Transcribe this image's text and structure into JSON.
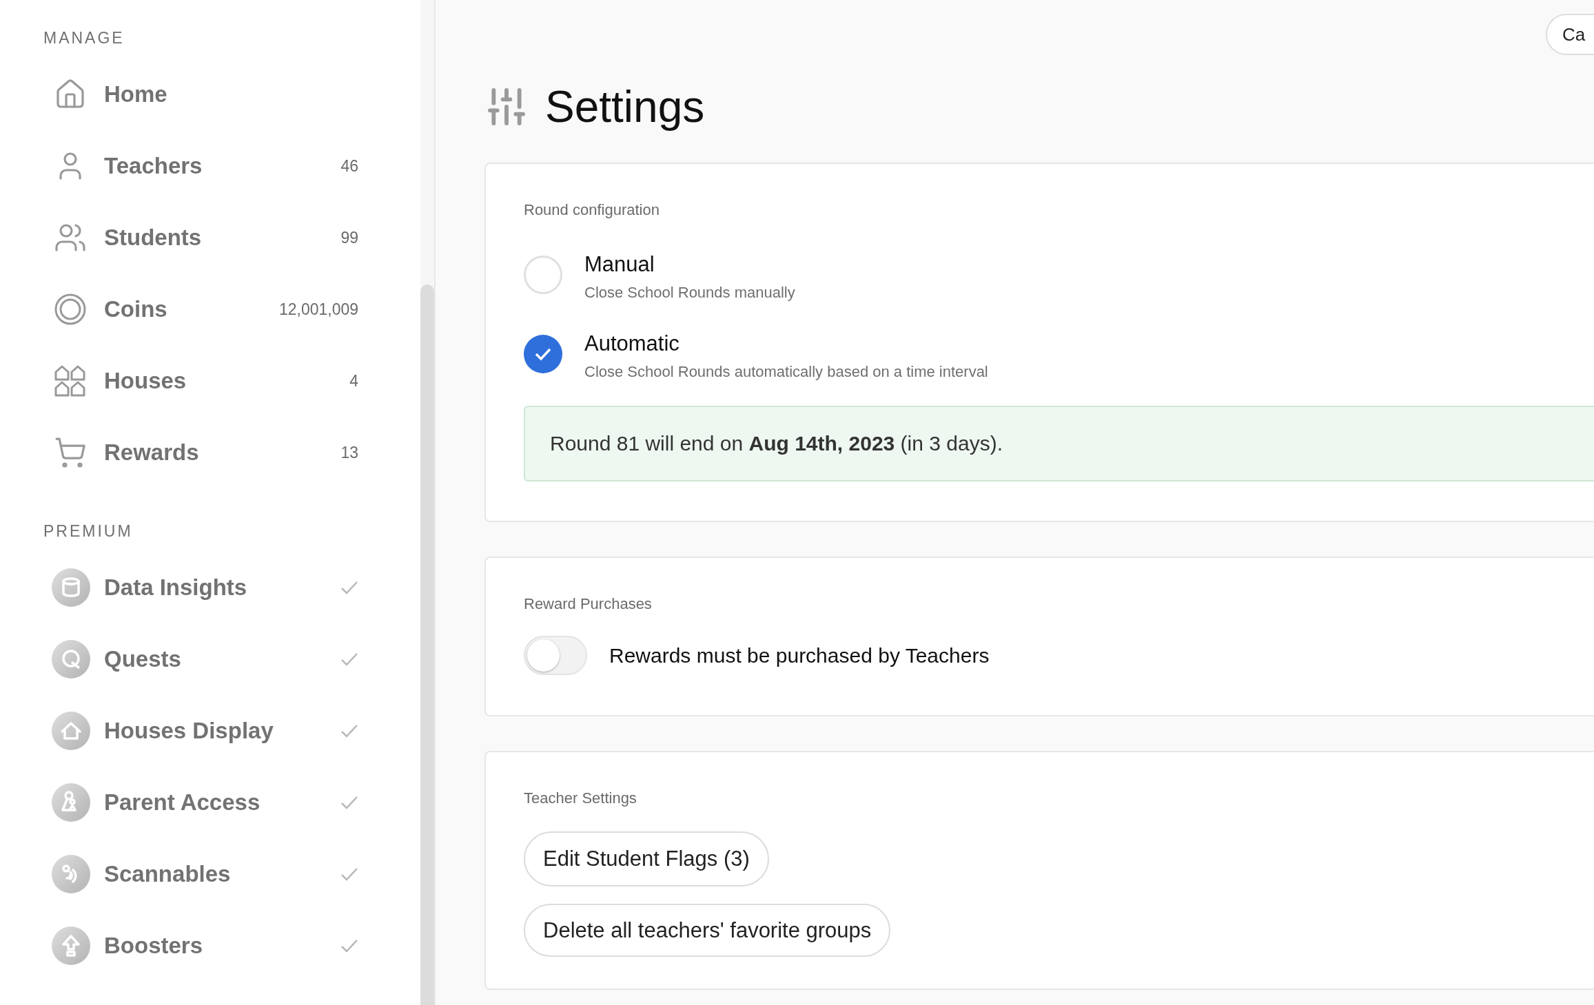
{
  "sidebar": {
    "manage": {
      "title": "MANAGE",
      "items": [
        {
          "label": "Home"
        },
        {
          "label": "Teachers",
          "count": "46"
        },
        {
          "label": "Students",
          "count": "99"
        },
        {
          "label": "Coins",
          "count": "12,001,009"
        },
        {
          "label": "Houses",
          "count": "4"
        },
        {
          "label": "Rewards",
          "count": "13"
        }
      ]
    },
    "premium": {
      "title": "PREMIUM",
      "items": [
        {
          "label": "Data Insights",
          "checked": true
        },
        {
          "label": "Quests",
          "checked": true
        },
        {
          "label": "Houses Display",
          "checked": true
        },
        {
          "label": "Parent Access",
          "checked": true
        },
        {
          "label": "Scannables",
          "checked": true
        },
        {
          "label": "Boosters",
          "checked": true
        }
      ]
    }
  },
  "top_button": {
    "label": "Ca"
  },
  "page_title": "Settings",
  "round_configuration": {
    "heading": "Round configuration",
    "options": [
      {
        "label": "Manual",
        "description": "Close School Rounds manually",
        "selected": false
      },
      {
        "label": "Automatic",
        "description": "Close School Rounds automatically based on a time interval",
        "selected": true
      }
    ],
    "notice": "Round 81 will end on **Aug 14th, 2023** (in 3 days)."
  },
  "reward_purchases": {
    "heading": "Reward Purchases",
    "toggle": {
      "label": "Rewards must be purchased by Teachers",
      "on": false
    }
  },
  "teacher_settings": {
    "heading": "Teacher Settings",
    "buttons": [
      "Edit Student Flags (3)",
      "Delete all teachers' favorite groups"
    ]
  }
}
